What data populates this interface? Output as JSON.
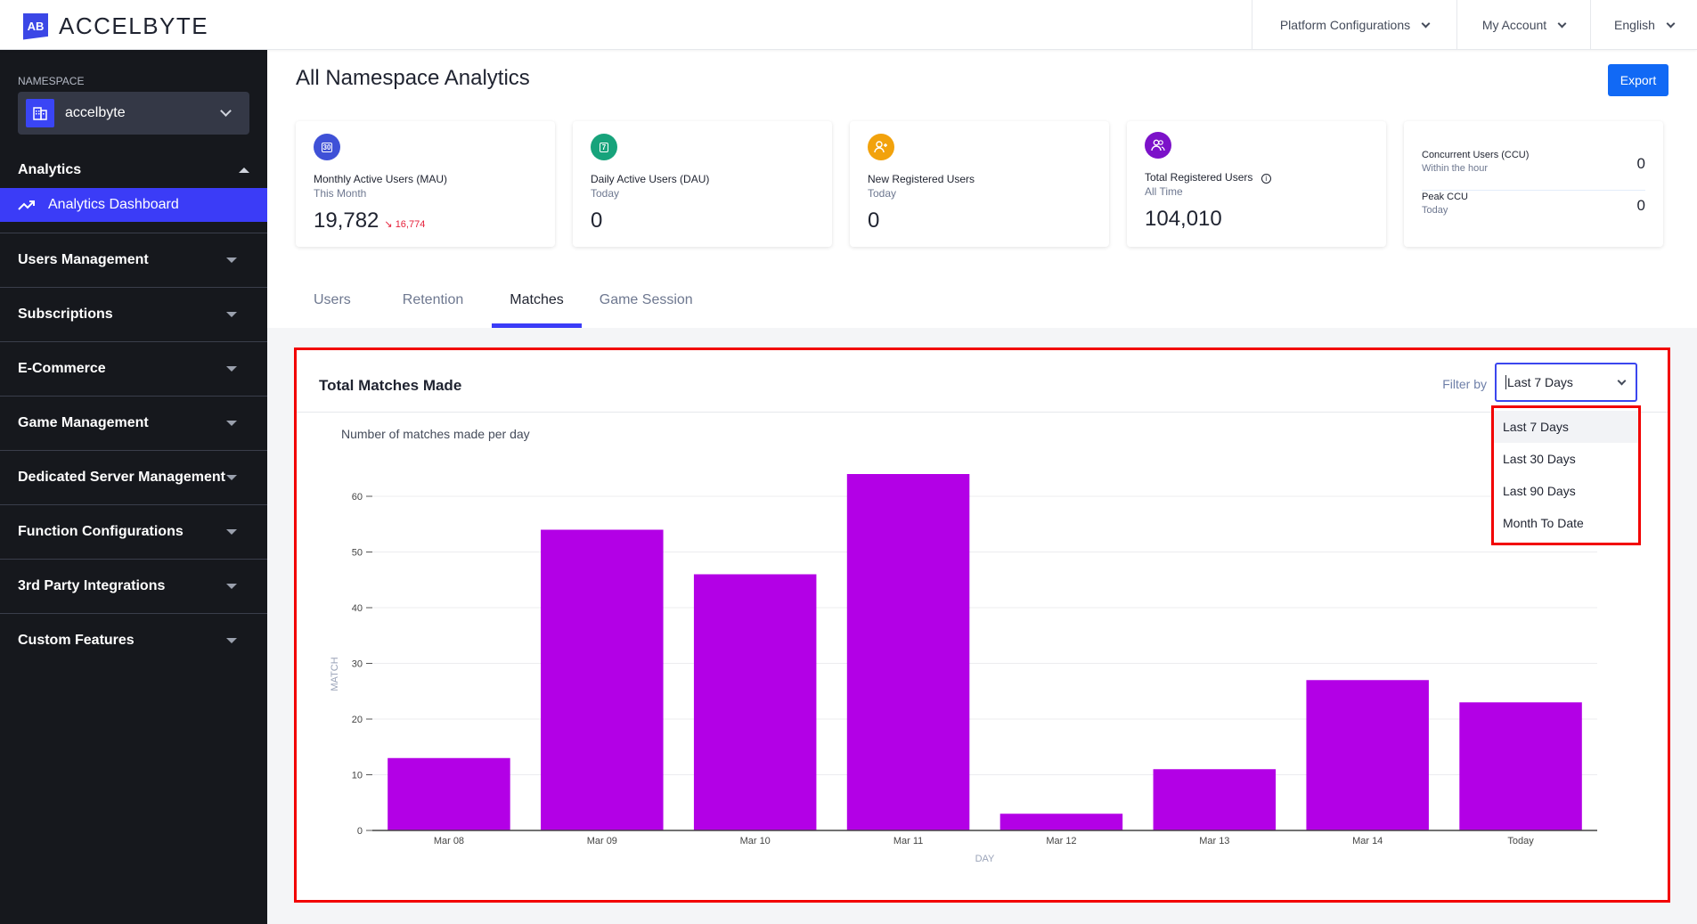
{
  "header": {
    "logo_mark": "AB",
    "logo_text": "ACCELBYTE",
    "nav": [
      {
        "label": "Platform Configurations"
      },
      {
        "label": "My Account"
      },
      {
        "label": "English"
      }
    ]
  },
  "sidebar": {
    "namespace_label": "NAMESPACE",
    "namespace_value": "accelbyte",
    "section_title": "Analytics",
    "active_item": "Analytics Dashboard",
    "items": [
      {
        "label": "Users Management"
      },
      {
        "label": "Subscriptions"
      },
      {
        "label": "E-Commerce"
      },
      {
        "label": "Game Management"
      },
      {
        "label": "Dedicated Server Management"
      },
      {
        "label": "Function Configurations"
      },
      {
        "label": "3rd Party Integrations"
      },
      {
        "label": "Custom Features"
      }
    ]
  },
  "page": {
    "title": "All Namespace Analytics",
    "export_label": "Export"
  },
  "cards": [
    {
      "icon": "calendar-30-icon",
      "icon_text": "30",
      "color": "#3f51d7",
      "label": "Monthly Active Users (MAU)",
      "sub": "This Month",
      "value": "19,782",
      "delta": "16,774",
      "delta_direction": "down"
    },
    {
      "icon": "calendar-7-icon",
      "icon_text": "7",
      "color": "#17a37b",
      "label": "Daily Active Users (DAU)",
      "sub": "Today",
      "value": "0"
    },
    {
      "icon": "user-plus-icon",
      "color": "#f2a20c",
      "label": "New Registered Users",
      "sub": "Today",
      "value": "0"
    },
    {
      "icon": "users-icon",
      "color": "#7c12c9",
      "label": "Total Registered Users",
      "sub": "All Time",
      "value": "104,010",
      "info": true
    }
  ],
  "ccu_card": {
    "rows": [
      {
        "label": "Concurrent Users (CCU)",
        "sub": "Within the hour",
        "value": "0"
      },
      {
        "label": "Peak CCU",
        "sub": "Today",
        "value": "0"
      }
    ]
  },
  "tabs": [
    {
      "label": "Users",
      "active": false
    },
    {
      "label": "Retention",
      "active": false
    },
    {
      "label": "Matches",
      "active": true
    },
    {
      "label": "Game Session",
      "active": false
    }
  ],
  "matches_panel": {
    "title": "Total Matches Made",
    "filter_label": "Filter by",
    "filter_value": "Last 7 Days",
    "filter_options": [
      "Last 7 Days",
      "Last 30 Days",
      "Last 90 Days",
      "Month To Date"
    ],
    "highlighted_option": "Last 7 Days"
  },
  "colors": {
    "accent": "#3b3cf7",
    "bar": "#b300e6",
    "export_button": "#1169f5",
    "annotation_border": "#f20000"
  },
  "chart_data": {
    "type": "bar",
    "title": "Number of matches made per day",
    "xlabel": "DAY",
    "ylabel": "MATCH",
    "categories": [
      "Mar 08",
      "Mar 09",
      "Mar 10",
      "Mar 11",
      "Mar 12",
      "Mar 13",
      "Mar 14",
      "Today"
    ],
    "values": [
      13,
      54,
      46,
      64,
      3,
      11,
      27,
      23
    ],
    "yticks": [
      0,
      10,
      20,
      30,
      40,
      50,
      60
    ],
    "ylim": [
      0,
      60
    ],
    "grid": true,
    "legend": "none"
  }
}
